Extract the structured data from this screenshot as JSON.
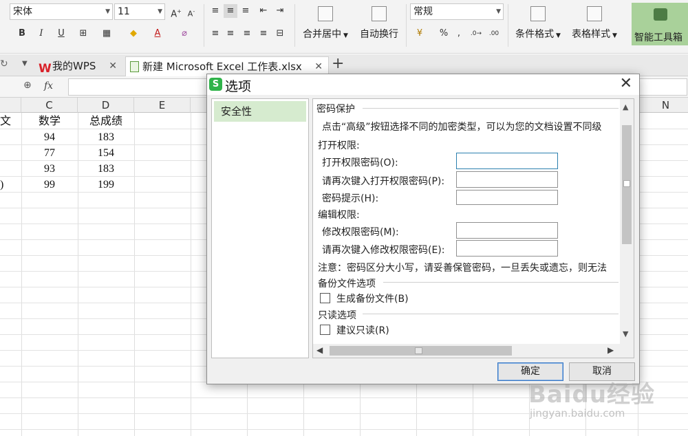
{
  "ribbon": {
    "font_name": "宋体",
    "font_size": "11",
    "number_format": "常规",
    "merge_center": "合并居中",
    "wrap_text": "自动换行",
    "conditional_format": "条件格式",
    "table_style": "表格样式",
    "smart_toolbox": "智能工具箱",
    "percent": "%",
    "comma": ","
  },
  "tabs": [
    {
      "label": "我的WPS"
    },
    {
      "label": "新建 Microsoft Excel 工作表.xlsx"
    }
  ],
  "formula_bar": {
    "fx": "fx"
  },
  "columns": {
    "c": "C",
    "d": "D",
    "e": "E",
    "n": "N"
  },
  "sheet": {
    "headers": {
      "b_partial": "文",
      "c": "数学",
      "d": "总成绩"
    },
    "rows": [
      {
        "b": "",
        "c": "94",
        "d": "183"
      },
      {
        "b": "",
        "c": "77",
        "d": "154"
      },
      {
        "b": "",
        "c": "93",
        "d": "183"
      },
      {
        "b": ")",
        "c": "99",
        "d": "199"
      }
    ]
  },
  "dialog": {
    "title": "选项",
    "sidebar_item": "安全性",
    "password_section": "密码保护",
    "password_desc": "点击“高级”按钮选择不同的加密类型，可以为您的文档设置不同级",
    "open_perm": "打开权限:",
    "open_pwd": "打开权限密码(O):",
    "open_pwd_confirm": "请再次键入打开权限密码(P):",
    "pwd_hint": "密码提示(H):",
    "edit_perm": "编辑权限:",
    "modify_pwd": "修改权限密码(M):",
    "modify_pwd_confirm": "请再次键入修改权限密码(E):",
    "note": "注意：密码区分大小写，请妥善保管密码，一旦丢失或遗忘，则无法",
    "backup_section": "备份文件选项",
    "backup_checkbox": "生成备份文件(B)",
    "readonly_section": "只读选项",
    "readonly_checkbox": "建议只读(R)",
    "ok": "确定",
    "cancel": "取消"
  },
  "watermark": {
    "brand": "Baidu经验",
    "url": "jingyan.baidu.com"
  }
}
